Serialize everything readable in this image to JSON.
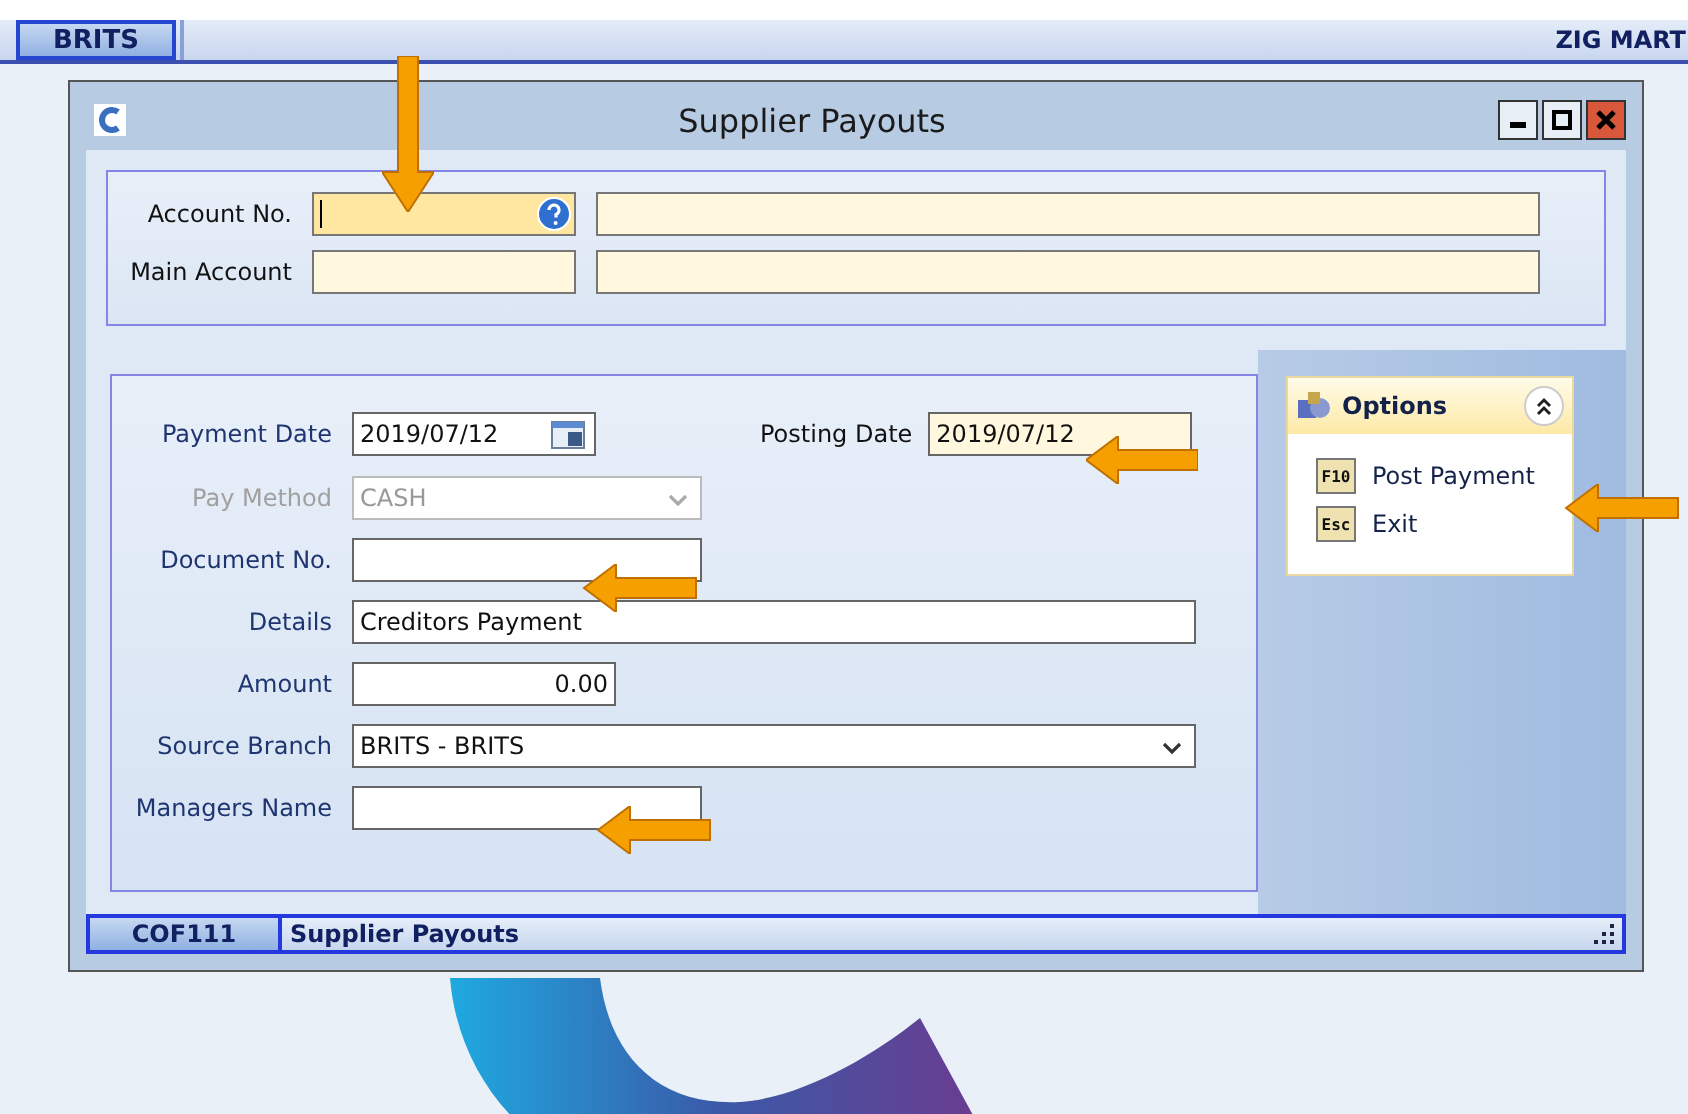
{
  "top_bar": {
    "branch": "BRITS",
    "company": "ZIG MART"
  },
  "window": {
    "title": "Supplier Payouts"
  },
  "account_fields": [
    {
      "label": "Account No.",
      "focused": true,
      "lookup": true
    },
    {
      "label": "Main Account",
      "focused": false,
      "lookup": false
    }
  ],
  "payment_date": {
    "label": "Payment Date",
    "value": "2019/07/12"
  },
  "posting_date": {
    "label": "Posting Date",
    "value": "2019/07/12"
  },
  "form_fields": [
    {
      "kind": "combo",
      "label": "Pay Method",
      "value": "CASH",
      "disabled": true
    },
    {
      "kind": "text",
      "label": "Document No.",
      "disabled": false
    },
    {
      "kind": "description",
      "label": "Details",
      "value": "Creditors Payment",
      "disabled": false
    },
    {
      "kind": "amount",
      "label": "Amount",
      "value": "0.00",
      "disabled": false
    },
    {
      "kind": "dropdown",
      "label": "Source Branch",
      "value": "BRITS - BRITS",
      "disabled": false
    },
    {
      "kind": "text",
      "label": "Managers Name",
      "disabled": false
    }
  ],
  "options": {
    "title": "Options",
    "expanded": true,
    "items": [
      {
        "key": "F10",
        "label": "Post Payment"
      },
      {
        "key": "Esc",
        "label": "Exit"
      }
    ]
  },
  "status_bar": {
    "code": "COF111",
    "text": "Supplier Payouts"
  }
}
